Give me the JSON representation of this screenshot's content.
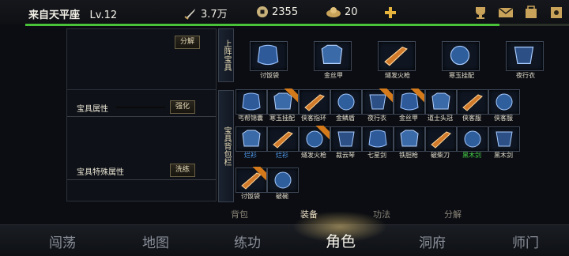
{
  "top": {
    "player_name": "来自天平座",
    "level": "Lv.12",
    "power": "3.7万",
    "coins": "2355",
    "ingots": "20"
  },
  "icons": [
    "sword-icon",
    "coin-icon",
    "ingot-icon",
    "plus-icon",
    "trophy-icon",
    "mail-icon",
    "bag-icon",
    "settings-icon"
  ],
  "left": {
    "decompose": "分解",
    "attr_label": "宝具属性",
    "strengthen": "强化",
    "special_label": "宝具特殊属性",
    "refine": "洗练"
  },
  "right": {
    "equipped_tab": "上阵宝具",
    "bag_tab": "宝具背包栏",
    "equipped": [
      {
        "name": "讨饭袋",
        "icon": "bag-item-icon"
      },
      {
        "name": "金丝甲",
        "icon": "armor-item-icon"
      },
      {
        "name": "燧发火枪",
        "icon": "gun-item-icon"
      },
      {
        "name": "寒玉挂配",
        "icon": "jade-item-icon"
      },
      {
        "name": "夜行衣",
        "icon": "robe-item-icon"
      }
    ],
    "bag_rows": [
      [
        {
          "name": "丐帮锦囊",
          "ribbon": false,
          "color": ""
        },
        {
          "name": "寒玉挂配",
          "ribbon": true,
          "color": ""
        },
        {
          "name": "侠客指环",
          "ribbon": false,
          "color": ""
        },
        {
          "name": "金鳞盾",
          "ribbon": false,
          "color": ""
        },
        {
          "name": "夜行衣",
          "ribbon": true,
          "color": ""
        },
        {
          "name": "金丝甲",
          "ribbon": true,
          "color": ""
        },
        {
          "name": "道士头冠",
          "ribbon": false,
          "color": ""
        },
        {
          "name": "侠客服",
          "ribbon": false,
          "color": ""
        },
        {
          "name": "侠客服",
          "ribbon": false,
          "color": ""
        }
      ],
      [
        {
          "name": "烂衫",
          "ribbon": false,
          "color": "blue"
        },
        {
          "name": "烂衫",
          "ribbon": false,
          "color": "blue"
        },
        {
          "name": "燧发火枪",
          "ribbon": true,
          "color": ""
        },
        {
          "name": "裁云琴",
          "ribbon": false,
          "color": ""
        },
        {
          "name": "七星剑",
          "ribbon": false,
          "color": ""
        },
        {
          "name": "铁胆枪",
          "ribbon": false,
          "color": ""
        },
        {
          "name": "破柴刀",
          "ribbon": false,
          "color": ""
        },
        {
          "name": "黑木剑",
          "ribbon": false,
          "color": "green"
        },
        {
          "name": "黑木剑",
          "ribbon": false,
          "color": ""
        }
      ],
      [
        {
          "name": "讨饭袋",
          "ribbon": true,
          "color": ""
        },
        {
          "name": "破碗",
          "ribbon": false,
          "color": ""
        }
      ]
    ]
  },
  "panel_tabs": [
    "背包",
    "装备",
    "功法",
    "分解"
  ],
  "nav": [
    "闯荡",
    "地图",
    "练功",
    "角色",
    "洞府",
    "师门"
  ],
  "colors": {
    "accent_green": "#49c23a",
    "ribbon": "#d47a1a",
    "blue_name": "#55a6ff",
    "green_name": "#48d64a"
  }
}
